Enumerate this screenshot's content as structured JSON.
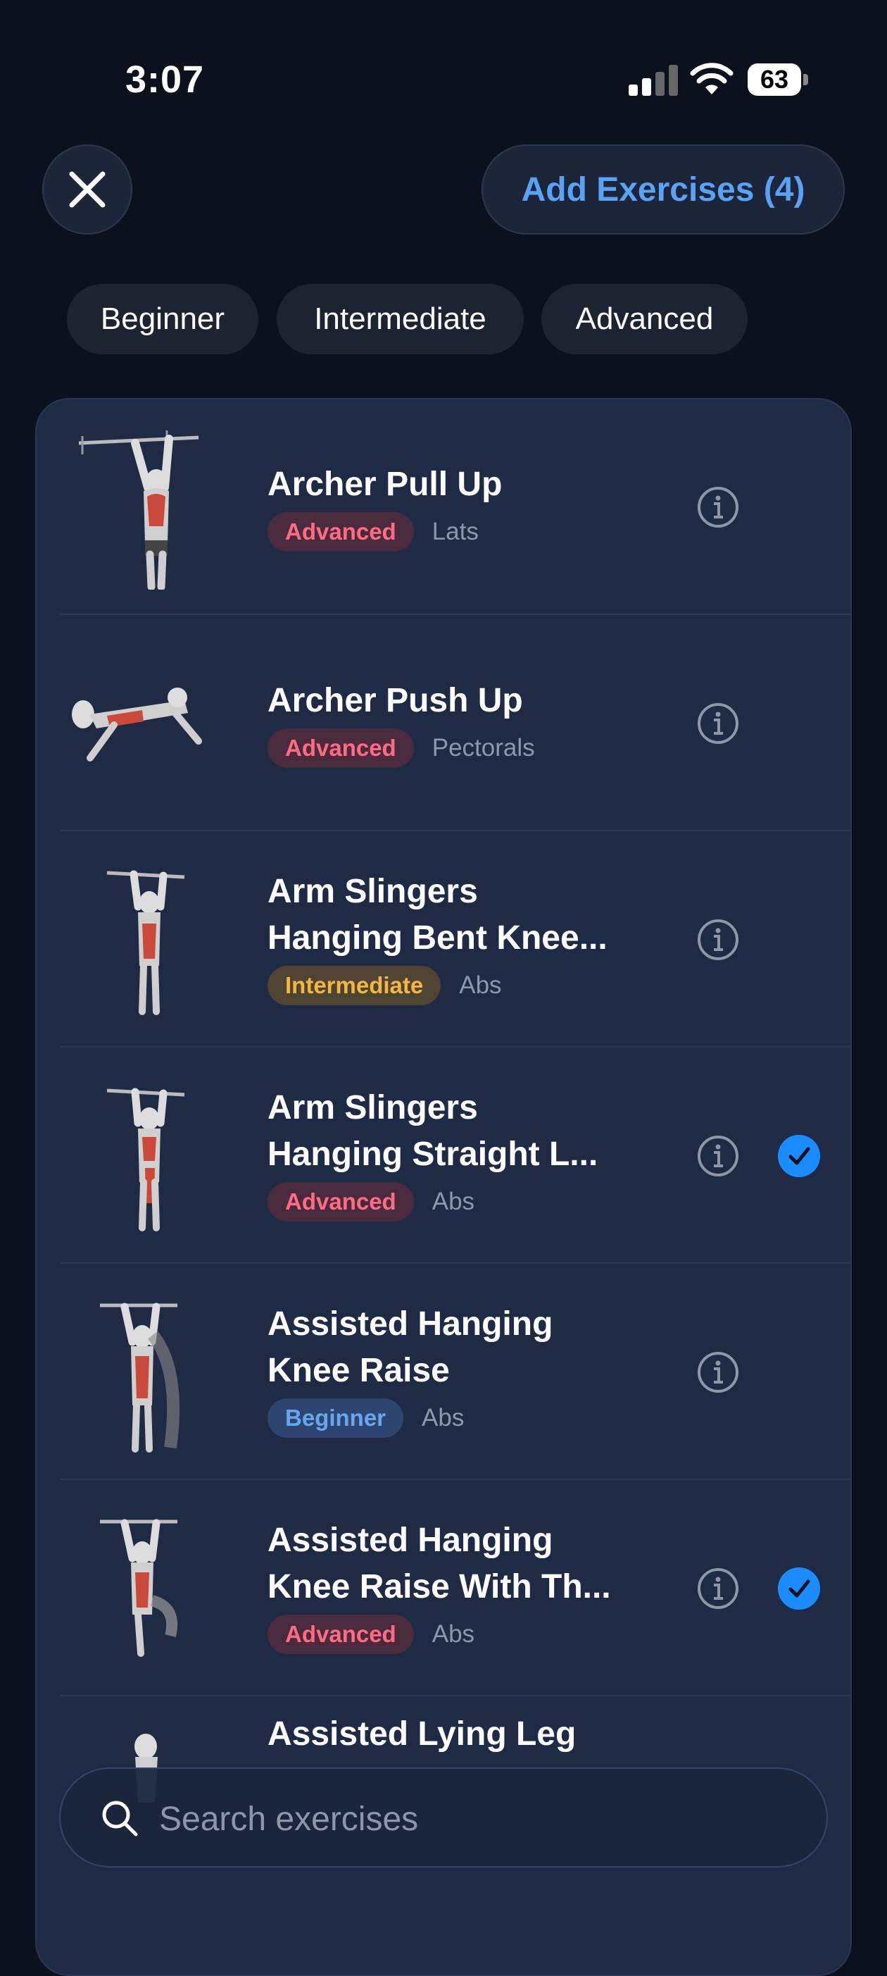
{
  "status_bar": {
    "time": "3:07",
    "battery": "63"
  },
  "header": {
    "add_label": "Add Exercises (4)"
  },
  "filters": [
    "Beginner",
    "Intermediate",
    "Advanced"
  ],
  "exercises": [
    {
      "title_lines": [
        "Archer Pull Up"
      ],
      "level": "Advanced",
      "muscle": "Lats",
      "selected": false
    },
    {
      "title_lines": [
        "Archer Push Up"
      ],
      "level": "Advanced",
      "muscle": "Pectorals",
      "selected": false
    },
    {
      "title_lines": [
        "Arm Slingers",
        "Hanging Bent Knee..."
      ],
      "level": "Intermediate",
      "muscle": "Abs",
      "selected": false
    },
    {
      "title_lines": [
        "Arm Slingers",
        "Hanging Straight L..."
      ],
      "level": "Advanced",
      "muscle": "Abs",
      "selected": true
    },
    {
      "title_lines": [
        "Assisted Hanging",
        "Knee Raise"
      ],
      "level": "Beginner",
      "muscle": "Abs",
      "selected": false
    },
    {
      "title_lines": [
        "Assisted Hanging",
        "Knee Raise With Th..."
      ],
      "level": "Advanced",
      "muscle": "Abs",
      "selected": true
    },
    {
      "title_lines": [
        "Assisted Lying Leg"
      ],
      "level": "",
      "muscle": "",
      "selected": false
    }
  ],
  "search": {
    "placeholder": "Search exercises"
  },
  "colors": {
    "accent": "#5aa2f5",
    "check": "#1a8cff",
    "advanced": "#ff6b81",
    "intermediate": "#f4b640",
    "beginner": "#6aa6f0"
  }
}
